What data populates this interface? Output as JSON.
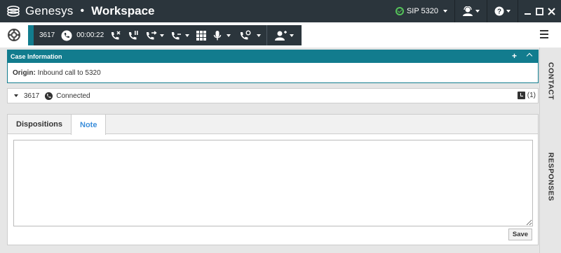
{
  "titlebar": {
    "brand": "Genesys",
    "separator": "•",
    "app_name": "Workspace",
    "sip_label": "SIP 5320",
    "sip_status_color": "#55c35a",
    "icons": [
      "genesys-logo-icon",
      "status-check-icon",
      "agent-icon",
      "help-icon",
      "minimize-icon",
      "maximize-icon",
      "close-icon"
    ]
  },
  "toolbar": {
    "call_number": "3617",
    "call_timer": "00:00:22",
    "accent_color": "#127c8e",
    "icons": [
      "phone-icon",
      "end-call-icon",
      "hold-call-icon",
      "transfer-call-icon",
      "conference-call-icon",
      "keypad-icon",
      "microphone-icon",
      "consult-call-icon",
      "add-party-icon",
      "hamburger-menu-icon"
    ]
  },
  "case": {
    "header": "Case Information",
    "origin_label": "Origin:",
    "origin_value": "Inbound call to 5320",
    "add_symbol": "+"
  },
  "connection": {
    "number": "3617",
    "status": "Connected",
    "history_count": "(1)"
  },
  "tabs": [
    {
      "label": "Dispositions",
      "active": false
    },
    {
      "label": "Note",
      "active": true
    }
  ],
  "note": {
    "save_label": "Save"
  },
  "sidebar": {
    "contact_label": "CONTACT",
    "responses_label": "RESPONSES"
  }
}
